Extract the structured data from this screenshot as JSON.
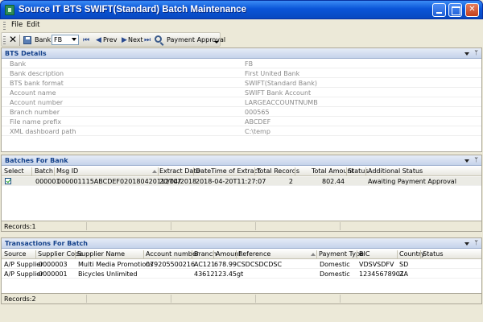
{
  "window": {
    "title": "Source IT BTS SWIFT(Standard) Batch Maintenance"
  },
  "menu": {
    "file": "File",
    "edit": "Edit"
  },
  "toolbar": {
    "bank_label": "Bank:",
    "bank_value": "FB",
    "prev_label": "Prev",
    "next_label": "Next",
    "payment_approval_label": "Payment Approval"
  },
  "bts_details": {
    "title": "BTS Details",
    "rows": [
      {
        "label": "Bank",
        "value": "FB"
      },
      {
        "label": "Bank description",
        "value": "First United Bank"
      },
      {
        "label": "BTS bank format",
        "value": "SWIFT(Standard Bank)"
      },
      {
        "label": "Account name",
        "value": "SWIFT Bank Account"
      },
      {
        "label": "Account number",
        "value": "LARGEACCOUNTNUMB"
      },
      {
        "label": "Branch number",
        "value": "000565"
      },
      {
        "label": "File name prefix",
        "value": "ABCDEF"
      },
      {
        "label": "XML dashboard path",
        "value": "C:\\temp"
      }
    ]
  },
  "batches": {
    "title": "Batches For Bank",
    "columns": [
      "Select",
      "Batch",
      "Msg ID",
      "Extract Date",
      "DateTime of Extract",
      "Total Records",
      "Total Amount",
      "Status",
      "Additional Status"
    ],
    "rows": [
      {
        "selected": true,
        "batch": "000001",
        "msg_id": "000001115ABCDEF020180420112707",
        "extract_date": "20/04/2018",
        "datetime_extract": "2018-04-20T11:27:07",
        "total_records": "2",
        "total_amount": "802.44",
        "status": "",
        "additional_status": "Awaiting Payment Approval"
      }
    ],
    "records": "Records:1"
  },
  "transactions": {
    "title": "Transactions For Batch",
    "columns": [
      "Source",
      "Supplier Code",
      "Supplier Name",
      "Account number",
      "Branch",
      "Amount",
      "Reference",
      "Payment Type",
      "BIC",
      "Country",
      "Status"
    ],
    "rows": [
      {
        "source": "A/P Supplier",
        "supplier_code": "0000003",
        "supplier_name": "Multi Media Promotions",
        "account_number": "079205500216",
        "branch": "AC121",
        "amount": "678.99",
        "reference": "CSDCSDCDSC",
        "payment_type": "Domestic",
        "bic": "VDSVSDFV",
        "country": "SD",
        "status": ""
      },
      {
        "source": "A/P Supplier",
        "supplier_code": "0000001",
        "supplier_name": "Bicycles Unlimited",
        "account_number": "",
        "branch": "43612",
        "amount": "123.45",
        "reference": "gt",
        "payment_type": "Domestic",
        "bic": "12345678901",
        "country": "ZA",
        "status": ""
      }
    ],
    "records": "Records:2"
  },
  "colors": {
    "title_bar": "#0a55d8",
    "panel_header": "#c5d3ea",
    "panel_title_text": "#15428b",
    "window_bg": "#ece9d8"
  }
}
